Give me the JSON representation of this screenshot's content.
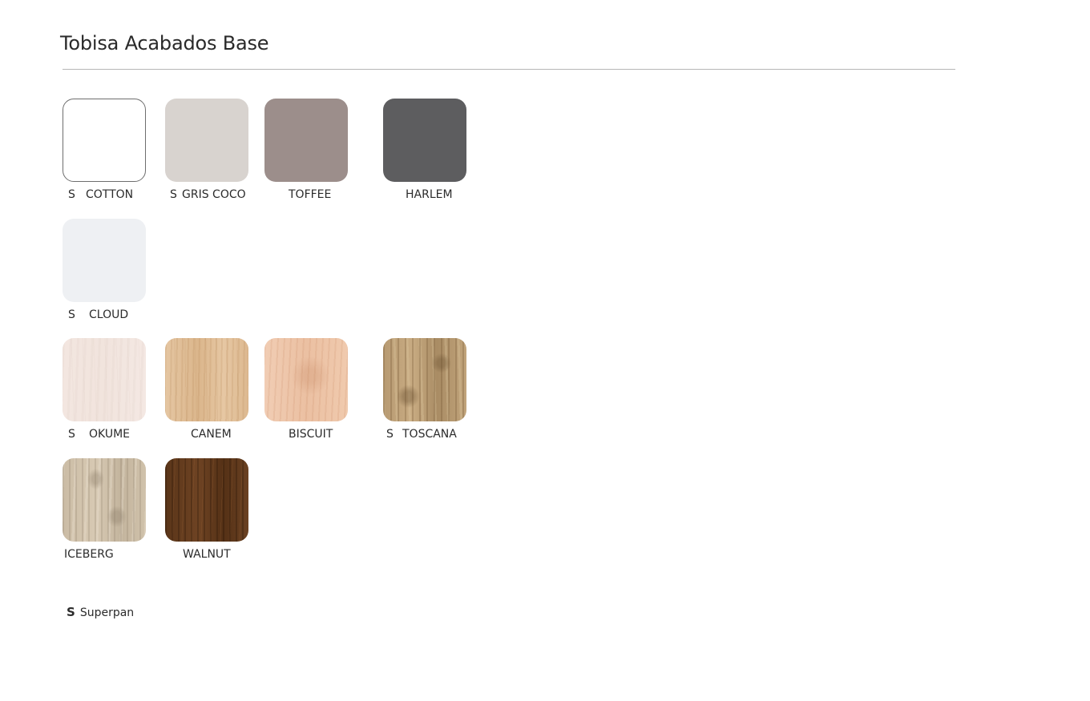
{
  "page": {
    "title": "Tobisa Acabados Base"
  },
  "swatches": [
    {
      "prefix": "S",
      "name": "COTTON",
      "color": "#ffffff",
      "border": "#6e6e6e",
      "texture": ""
    },
    {
      "prefix": "S",
      "name": "GRIS COCO",
      "color": "#d8d3cf",
      "border": "",
      "texture": ""
    },
    {
      "prefix": "",
      "name": "TOFFEE",
      "color": "#9c8e8b",
      "border": "",
      "texture": ""
    },
    {
      "prefix": "",
      "name": "HARLEM",
      "color": "#5d5d5f",
      "border": "",
      "texture": ""
    },
    {
      "prefix": "S",
      "name": "CLOUD",
      "color": "#eef0f3",
      "border": "",
      "texture": ""
    },
    {
      "prefix": "S",
      "name": "OKUME",
      "color": "#f2e5df",
      "border": "",
      "texture": "wood-okume"
    },
    {
      "prefix": "",
      "name": "CANEM",
      "color": "#e0bf98",
      "border": "",
      "texture": "wood-canem"
    },
    {
      "prefix": "",
      "name": "BISCUIT",
      "color": "#edc5a9",
      "border": "",
      "texture": "wood-biscuit"
    },
    {
      "prefix": "S",
      "name": "TOSCANA",
      "color": "#b99c74",
      "border": "",
      "texture": "wood-toscana"
    },
    {
      "prefix": "",
      "name": "ICEBERG",
      "color": "#cdbea7",
      "border": "",
      "texture": "wood-iceberg"
    },
    {
      "prefix": "",
      "name": "WALNUT",
      "color": "#603a1c",
      "border": "",
      "texture": "wood-walnut"
    }
  ],
  "legend": {
    "symbol": "S",
    "text": "Superpan"
  }
}
